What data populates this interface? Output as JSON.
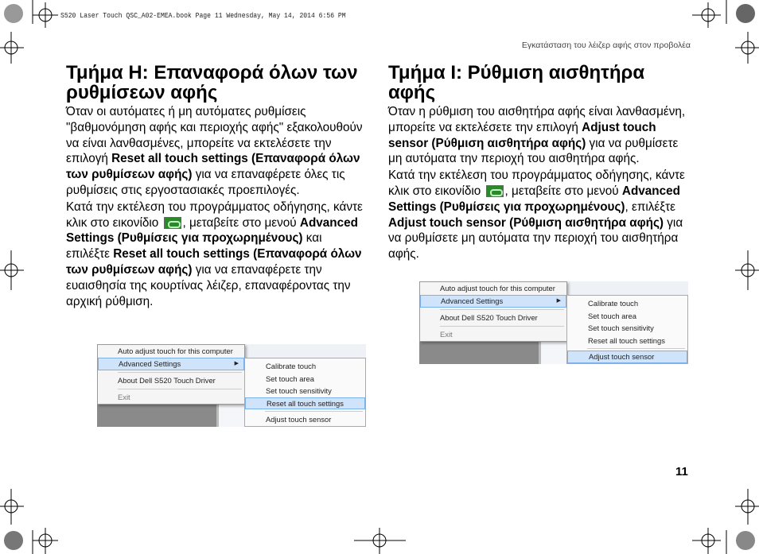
{
  "slug": "S520 Laser Touch QSC_A02-EMEA.book  Page 11  Wednesday, May 14, 2014  6:56 PM",
  "running_head": "Εγκατάσταση του λέιζερ αφής στον προβολέα",
  "page_number": "11",
  "left": {
    "title": "Τμήμα H: Επαναφορά όλων των ρυθμίσεων αφής",
    "p1": [
      "Όταν οι αυτόματες ή μη αυτόματες ρυθμίσεις \"βαθμονόμηση αφής και περιοχής αφής\" εξακολουθούν να είναι λανθασμένες, μπορείτε να εκτελέσετε την επιλογή ",
      "Reset all touch settings (Επαναφορά όλων των ρυθμίσεων αφής)",
      " για να επαναφέρετε όλες τις ρυθμίσεις στις εργοστασιακές προεπιλογές."
    ],
    "p2": [
      "Κατά την εκτέλεση του προγράμματος οδήγησης, κάντε κλικ στο εικονίδιο ",
      ", μεταβείτε στο μενού ",
      "Advanced Settings (Ρυθμίσεις για προχωρημένους)",
      " και επιλέξτε ",
      "Reset all touch settings (Επαναφορά όλων των ρυθμίσεων αφής)",
      " για να επαναφέρετε την ευαισθησία της κουρτίνας λέιζερ, επαναφέροντας την αρχική ρύθμιση."
    ]
  },
  "right": {
    "title": "Τμήμα I: Ρύθμιση αισθητήρα αφής",
    "p1": [
      "Όταν η ρύθμιση του αισθητήρα αφής είναι λανθασμένη, μπορείτε να εκτελέσετε την επιλογή ",
      "Adjust touch sensor (Ρύθμιση αισθητήρα αφής)",
      " για να ρυθμίσετε μη αυτόματα την περιοχή του αισθητήρα αφής."
    ],
    "p2": [
      "Κατά την εκτέλεση του προγράμματος οδήγησης, κάντε κλικ στο εικονίδιο ",
      ", μεταβείτε στο μενού ",
      "Advanced Settings (Ρυθμίσεις για προχωρημένους)",
      ", επιλέξτε ",
      "Adjust touch sensor (Ρύθμιση αισθητήρα αφής)",
      " για να ρυθμίσετε μη αυτόματα την περιοχή του αισθητήρα αφής."
    ]
  },
  "menu": {
    "items": [
      "Auto adjust touch for this computer",
      "Advanced Settings",
      "About Dell S520 Touch Driver",
      "Exit"
    ],
    "submenu": [
      "Calibrate touch",
      "Set touch area",
      "Set touch sensitivity",
      "Reset all touch settings",
      "Adjust touch sensor"
    ],
    "arrow": "▶"
  },
  "icons": {
    "driver": "touch-driver-tray-icon",
    "marks": "registration-mark-icon"
  }
}
